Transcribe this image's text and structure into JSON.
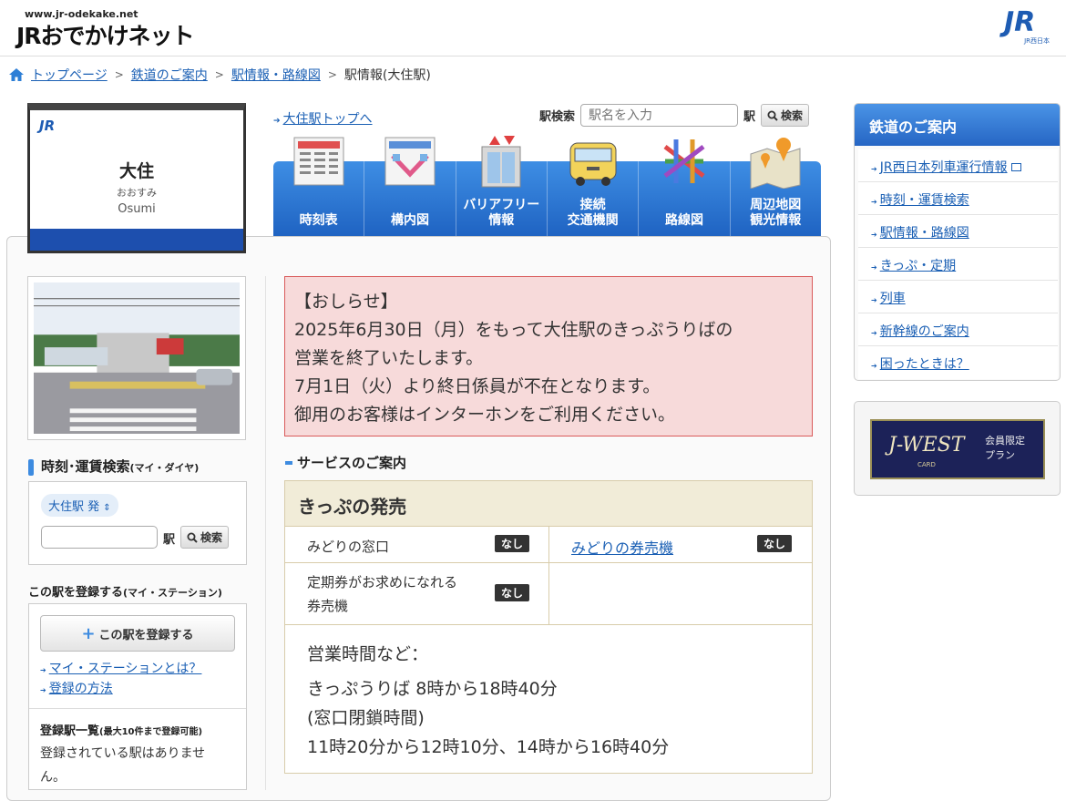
{
  "header": {
    "site_url": "www.jr-odekake.net",
    "site_name": "JRおでかけネット",
    "corp_logo": "JR",
    "corp_sub": "JR西日本"
  },
  "breadcrumb": [
    "トップページ",
    "鉄道のご案内",
    "駅情報・路線図",
    "駅情報(大住駅)"
  ],
  "station": {
    "mark": "JR",
    "name": "大住",
    "kana": "おおすみ",
    "roman": "Osumi"
  },
  "top_link": "大住駅トップへ",
  "search": {
    "label": "駅検索",
    "placeholder": "駅名を入力",
    "suffix": "駅",
    "button": "検索"
  },
  "nav": [
    {
      "label1": "時刻表",
      "label2": "",
      "icon": "timetable-icon"
    },
    {
      "label1": "構内図",
      "label2": "",
      "icon": "station-map-icon"
    },
    {
      "label1": "バリアフリー",
      "label2": "情報",
      "icon": "elevator-icon"
    },
    {
      "label1": "接続",
      "label2": "交通機関",
      "icon": "bus-icon"
    },
    {
      "label1": "路線図",
      "label2": "",
      "icon": "route-map-icon"
    },
    {
      "label1": "周辺地図",
      "label2": "観光情報",
      "icon": "area-map-icon"
    }
  ],
  "timesearch": {
    "title": "時刻･運賃検索",
    "title_small": "(マイ・ダイヤ)",
    "from": "大住駅 発",
    "suffix": "駅",
    "button": "検索"
  },
  "register": {
    "title": "この駅を登録する",
    "title_small": "(マイ・ステーション)",
    "button": "この駅を登録する",
    "link1": "マイ・ステーションとは？",
    "link2": "登録の方法",
    "list_title": "登録駅一覧",
    "list_small": "(最大10件まで登録可能)",
    "empty": "登録されている駅はありません。"
  },
  "notice": {
    "heading": "【おしらせ】",
    "line1": "2025年6月30日（月）をもって大住駅のきっぷうりばの",
    "line2": "営業を終了いたします。",
    "line3": "7月1日（火）より終日係員が不在となります。",
    "line4": "御用のお客様はインターホンをご利用ください。"
  },
  "service": {
    "title": "サービスのご案内",
    "table_head": "きっぷの発売",
    "row1_left": "みどりの窓口",
    "row1_left_badge": "なし",
    "row1_right": "みどりの券売機",
    "row1_right_badge": "なし",
    "row2_left_1": "定期券がお求めになれる",
    "row2_left_2": "券売機",
    "row2_left_badge": "なし",
    "hours_title": "営業時間など：",
    "hours_1": "きっぷうりば 8時から18時40分",
    "hours_2": "(窓口閉鎖時間)",
    "hours_3": "11時20分から12時10分、14時から16時40分"
  },
  "rail": {
    "title": "鉄道のご案内",
    "items": [
      "JR西日本列車運行情報",
      "時刻・運賃検索",
      "駅情報・路線図",
      "きっぷ・定期",
      "列車",
      "新幹線のご案内",
      "困ったときは？"
    ]
  },
  "banner": {
    "brand": "J-WEST",
    "card": "CARD",
    "plan1": "会員限定",
    "plan2": "プラン"
  }
}
